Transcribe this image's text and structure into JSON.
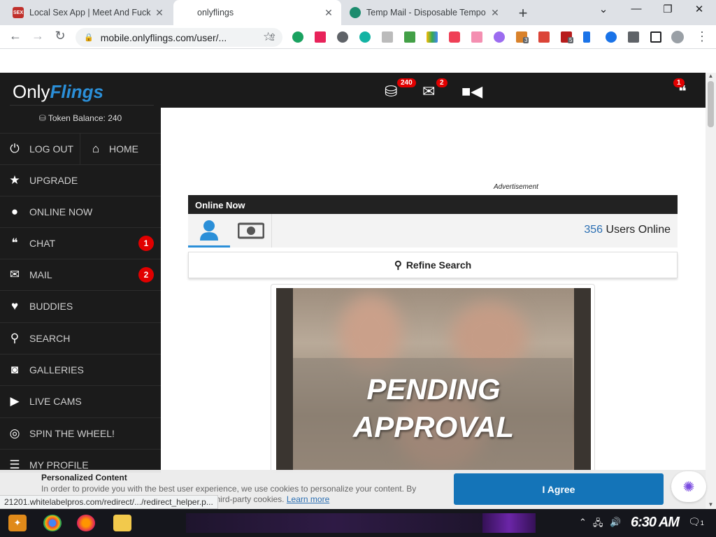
{
  "browser": {
    "tabs": [
      {
        "title": "Local Sex App | Meet And Fuck",
        "favicon": "SEX",
        "active": false
      },
      {
        "title": "onlyflings",
        "active": true
      },
      {
        "title": "Temp Mail - Disposable Tempo",
        "active": false
      }
    ],
    "url": "mobile.onlyflings.com/user/...",
    "status_url": "21201.whitelabelpros.com/redirect/.../redirect_helper.p...",
    "extension_badges": [
      "3",
      "5"
    ]
  },
  "site": {
    "logo_only": "Only",
    "logo_flings": "Flings",
    "token_balance": "Token Balance: 240",
    "menu": {
      "logout": "LOG OUT",
      "home": "HOME",
      "upgrade": "UPGRADE",
      "online_now": "ONLINE NOW",
      "chat": "CHAT",
      "chat_badge": "1",
      "mail": "MAIL",
      "mail_badge": "2",
      "buddies": "BUDDIES",
      "search": "SEARCH",
      "galleries": "GALLERIES",
      "live_cams": "LIVE CAMS",
      "spin": "SPIN THE WHEEL!",
      "my_profile": "MY PROFILE"
    },
    "topbar": {
      "tokens_badge": "240",
      "mail_badge": "2",
      "chat_badge": "1"
    },
    "main": {
      "ad_label": "Advertisement",
      "online_title": "Online Now",
      "users_count": "356",
      "users_label": "Users Online",
      "refine": "Refine Search",
      "pending_line1": "PENDING",
      "pending_line2": "APPROVAL"
    },
    "cookie": {
      "title": "Personalized Content",
      "text": "In order to provide you with the best user experience, we use cookies to personalize your content. By using our site, you agree to cookies, including third-party cookies.",
      "learn_more": "Learn more",
      "agree": "I Agree"
    }
  },
  "taskbar": {
    "clock": "6:30 AM",
    "notification_count": "1"
  },
  "colors": {
    "accent": "#2b8fd8",
    "badge_red": "#e10000",
    "agree_button": "#1474b8",
    "sidebar_bg": "#1b1b1b"
  }
}
